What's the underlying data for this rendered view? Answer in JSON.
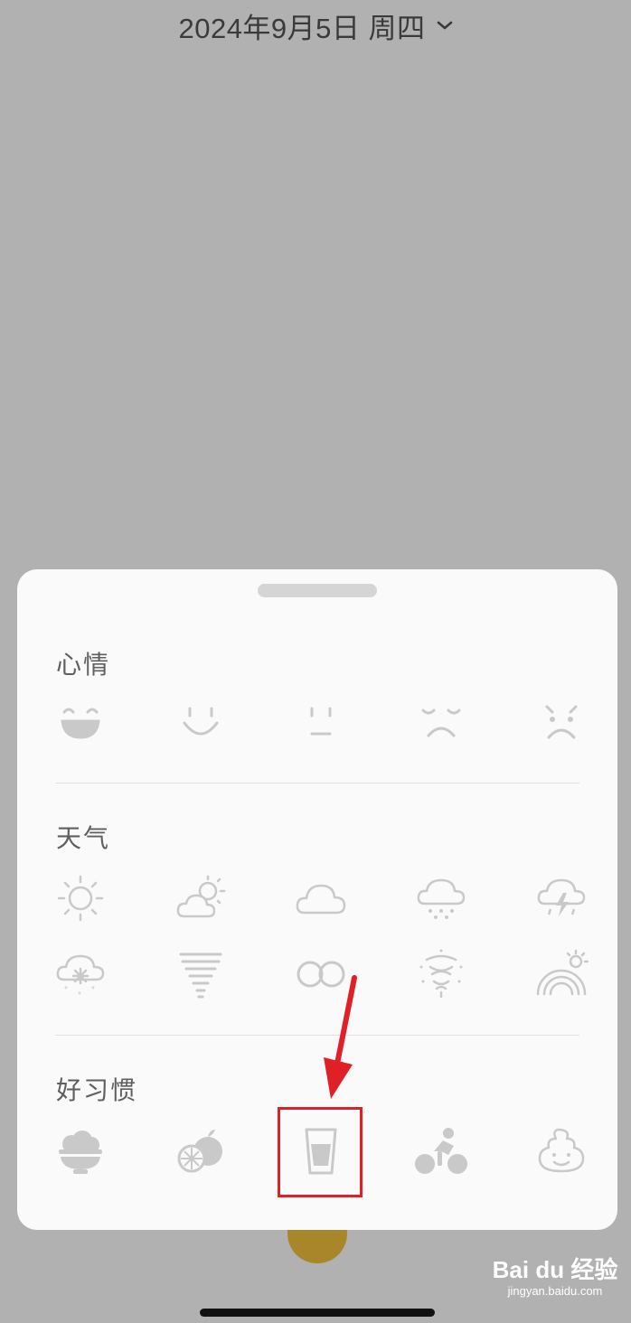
{
  "header": {
    "date_label": "2024年9月5日 周四"
  },
  "sheet": {
    "sections": [
      {
        "title": "心情",
        "icons": [
          "laughing-face-icon",
          "smile-face-icon",
          "neutral-face-icon",
          "upset-face-icon",
          "sad-face-icon"
        ]
      },
      {
        "title": "天气",
        "icons": [
          "sunny-icon",
          "partly-cloudy-icon",
          "cloudy-icon",
          "rain-icon",
          "thunderstorm-icon",
          "snow-icon",
          "tornado-icon",
          "fog-icon",
          "typhoon-icon",
          "rainbow-icon"
        ]
      },
      {
        "title": "好习惯",
        "icons": [
          "meal-bowl-icon",
          "fruit-icon",
          "water-glass-icon",
          "cycling-icon",
          "poop-icon"
        ]
      }
    ]
  },
  "annotation": {
    "highlight_color": "#e02026",
    "highlighted_item": "water-glass-icon"
  },
  "watermark": {
    "brand": "Bai du 经验",
    "url": "jingyan.baidu.com"
  },
  "colors": {
    "background": "#b1b1b1",
    "sheet": "#fbfafa",
    "icon": "#c9c9c9",
    "fab": "#a8862a"
  }
}
